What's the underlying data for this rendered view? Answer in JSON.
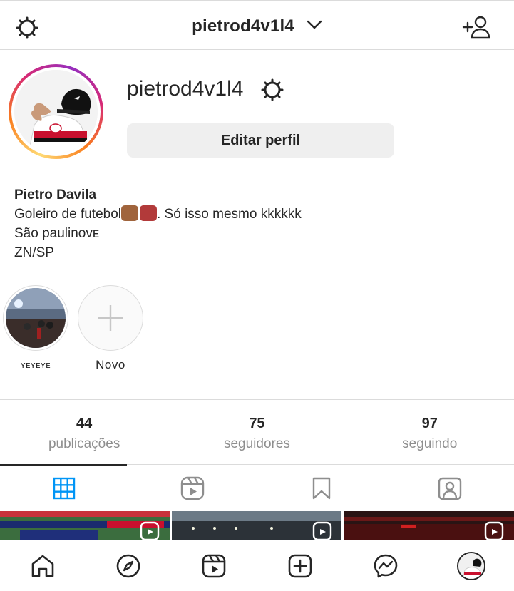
{
  "header": {
    "username": "pietrod4v1l4",
    "settings_icon": "gear-icon",
    "dropdown_icon": "chevron-down-icon",
    "add_user_icon": "add-user-icon"
  },
  "profile": {
    "handle": "pietrod4v1l4",
    "edit_button": "Editar perfil",
    "name": "Pietro Davila",
    "bio_line1_a": "Goleiro de futebol",
    "bio_line1_b": ". Só isso mesmo kkkkkk",
    "bio_line2": "São paulinoᴠᴇ",
    "bio_line3": "ZN/SP"
  },
  "highlights": [
    {
      "label": "ʏᴇʏᴇʏᴇ"
    },
    {
      "label": "Novo"
    }
  ],
  "stats": {
    "posts": {
      "count": "44",
      "label": "publicações"
    },
    "followers": {
      "count": "75",
      "label": "seguidores"
    },
    "following": {
      "count": "97",
      "label": "seguindo"
    }
  },
  "tabs": [
    "grid-icon",
    "reels-icon",
    "saved-icon",
    "tagged-icon"
  ],
  "bottom_nav": [
    "home-icon",
    "explore-icon",
    "reels-icon",
    "new-post-icon",
    "messenger-icon",
    "profile-avatar"
  ],
  "colors": {
    "accent_blue": "#0095f6",
    "text": "#262626",
    "secondary": "#8e8e8e",
    "button_bg": "#efefef",
    "border": "#dbdbdb"
  }
}
